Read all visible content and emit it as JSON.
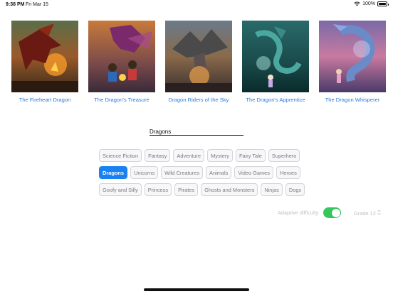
{
  "status_bar": {
    "time": "9:38 PM",
    "date": "Fri Mar 15",
    "battery": "100%",
    "battery_level": 1.0
  },
  "books": [
    {
      "title": "The Fireheart Dragon"
    },
    {
      "title": "The Dragon's Treasure"
    },
    {
      "title": "Dragon Riders of the Sky"
    },
    {
      "title": "The Dragon's Apprentice"
    },
    {
      "title": "The Dragon Whisperer"
    }
  ],
  "search": {
    "value": "Dragons"
  },
  "categories": {
    "row1": [
      "Science Fiction",
      "Fantasy",
      "Adventure",
      "Mystery",
      "Fairy Tale",
      "Superhero"
    ],
    "row2": [
      "Dragons",
      "Unicorns",
      "Wild Creatures",
      "Animals",
      "Video Games",
      "Heroes"
    ],
    "row3": [
      "Goofy and Silly",
      "Princess",
      "Pirates",
      "Ghosts and Monsters",
      "Ninjas",
      "Dogs"
    ],
    "selected": "Dragons"
  },
  "settings": {
    "adaptive_label": "Adaptive difficulty",
    "adaptive_enabled": true,
    "grade_label": "Grade 12"
  },
  "colors": {
    "accent": "#1a82f0",
    "link": "#2a7ad8",
    "toggle_on": "#34c759"
  }
}
